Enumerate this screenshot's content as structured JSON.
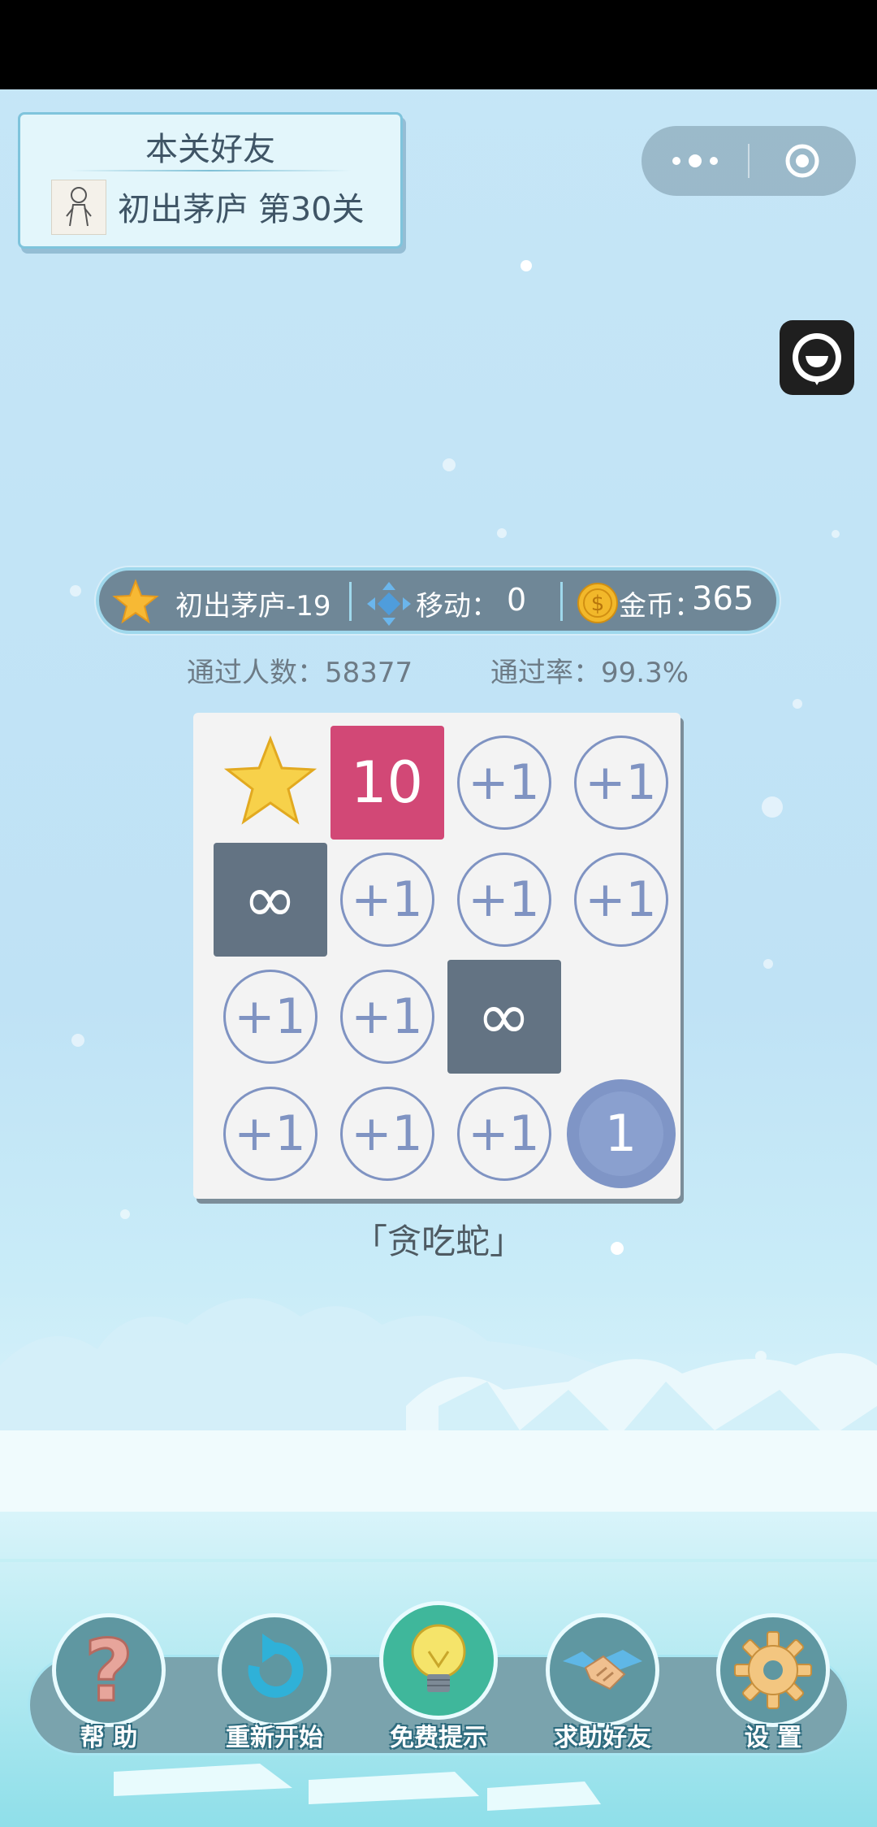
{
  "friend_panel": {
    "title": "本关好友",
    "level_text": "初出茅庐 第30关"
  },
  "info_bar": {
    "level": "初出茅庐-19",
    "moves_label": "移动：",
    "moves_value": "0",
    "gold_label": "金币：",
    "gold_value": "365"
  },
  "stats": {
    "passed_count": "通过人数：58377",
    "pass_rate": "通过率：99.3%"
  },
  "board": {
    "rows": [
      [
        {
          "type": "star",
          "label": ""
        },
        {
          "type": "number",
          "label": "10"
        },
        {
          "type": "plus",
          "label": "+1"
        },
        {
          "type": "plus",
          "label": "+1"
        }
      ],
      [
        {
          "type": "infinity",
          "label": "∞"
        },
        {
          "type": "plus",
          "label": "+1"
        },
        {
          "type": "plus",
          "label": "+1"
        },
        {
          "type": "plus",
          "label": "+1"
        }
      ],
      [
        {
          "type": "plus",
          "label": "+1"
        },
        {
          "type": "plus",
          "label": "+1"
        },
        {
          "type": "infinity",
          "label": "∞"
        },
        {
          "type": "empty",
          "label": ""
        }
      ],
      [
        {
          "type": "plus",
          "label": "+1"
        },
        {
          "type": "plus",
          "label": "+1"
        },
        {
          "type": "plus",
          "label": "+1"
        },
        {
          "type": "player",
          "label": "1"
        }
      ]
    ]
  },
  "level_name": "「贪吃蛇」",
  "toolbar": {
    "help": "帮 助",
    "restart": "重新开始",
    "hint": "免费提示",
    "ask_friend": "求助好友",
    "settings": "设 置"
  },
  "colors": {
    "tile_ten": "#d24876",
    "tile_infinity": "#637383",
    "tile_plus": "#7f93c2",
    "player": "#7f95c6"
  },
  "icons": [
    "star-icon",
    "move-arrows-icon",
    "coin-icon",
    "question-mark-icon",
    "restart-arrow-icon",
    "lightbulb-icon",
    "handshake-icon",
    "gear-icon",
    "more-dots-icon",
    "target-icon",
    "chat-bubble-icon"
  ]
}
